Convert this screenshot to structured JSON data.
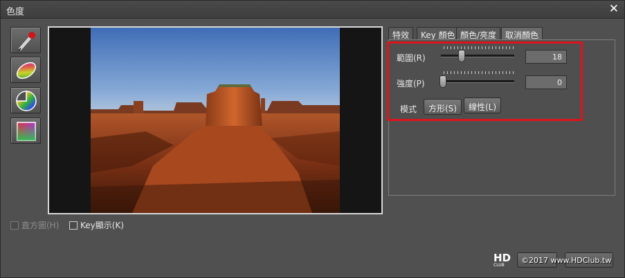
{
  "window": {
    "title": "色度",
    "close_glyph": "✕"
  },
  "tools": [
    {
      "name": "eyedropper-icon"
    },
    {
      "name": "color-ellipse-icon"
    },
    {
      "name": "color-wheel-icon"
    },
    {
      "name": "color-square-icon"
    }
  ],
  "preview": {
    "image": "desert-monument-valley-photo"
  },
  "checkboxes": {
    "histogram": {
      "label": "直方圖(H)",
      "checked": false,
      "enabled": false
    },
    "key_display": {
      "label": "Key顯示(K)",
      "checked": false,
      "enabled": true
    }
  },
  "tabs": [
    {
      "label": "特效",
      "active": false
    },
    {
      "label": "Key 顏色",
      "active": false
    },
    {
      "label": "顏色/亮度",
      "active": false
    },
    {
      "label": "取消顏色",
      "active": true
    }
  ],
  "controls": {
    "range": {
      "label": "範圍(R)",
      "value": "18"
    },
    "intensity": {
      "label": "強度(P)",
      "value": "0"
    },
    "mode": {
      "label": "模式",
      "square_button": "方形(S)",
      "linear_button": "線性(L)"
    }
  },
  "watermark": {
    "text": "©2017 www.HDClub.tw"
  },
  "colors": {
    "highlight": "#e0131a"
  }
}
